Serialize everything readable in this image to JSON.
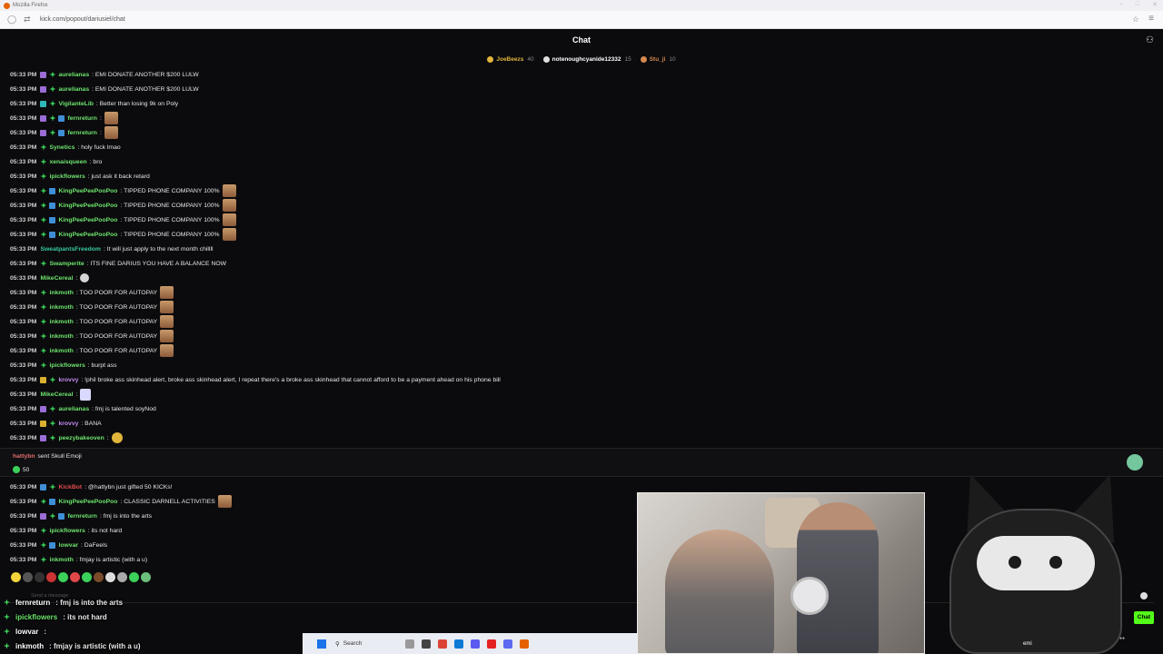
{
  "browser": {
    "title": "Mozilla Firefox",
    "url": "kick.com/popout/dariusiel/chat"
  },
  "chat": {
    "title": "Chat",
    "leaderboard": [
      {
        "user": "JoeBeezs",
        "count": "40",
        "color": "#e1b53b"
      },
      {
        "user": "notenoughcyanide12332",
        "count": "15",
        "color": "#e0e0e0"
      },
      {
        "user": "Stu_ji",
        "count": "10",
        "color": "#d5884f"
      }
    ],
    "messages": [
      {
        "ts": "05:33 PM",
        "badges": [
          "sub",
          "gift"
        ],
        "user": "aurelianas",
        "color": "#6ee46e",
        "text": ": EMI DONATE ANOTHER $200 LULW",
        "emote": ""
      },
      {
        "ts": "05:33 PM",
        "badges": [
          "sub",
          "gift"
        ],
        "user": "aurelianas",
        "color": "#6ee46e",
        "text": ": EMI DONATE ANOTHER $200 LULW",
        "emote": ""
      },
      {
        "ts": "05:33 PM",
        "badges": [
          "bot",
          "gift"
        ],
        "user": "VigilanteLib",
        "color": "#6ee46e",
        "text": ": Better than losing 9k on Poly",
        "emote": ""
      },
      {
        "ts": "05:33 PM",
        "badges": [
          "sub",
          "gift",
          "blue"
        ],
        "user": "fernreturn",
        "color": "#6ee46e",
        "text": ":",
        "emote": "face"
      },
      {
        "ts": "05:33 PM",
        "badges": [
          "sub",
          "gift",
          "blue"
        ],
        "user": "fernreturn",
        "color": "#6ee46e",
        "text": ":",
        "emote": "face"
      },
      {
        "ts": "05:33 PM",
        "badges": [
          "gift"
        ],
        "user": "Synetics",
        "color": "#6ee46e",
        "text": ": holy fuck lmao",
        "emote": ""
      },
      {
        "ts": "05:33 PM",
        "badges": [
          "gift"
        ],
        "user": "xenaisqueen",
        "color": "#6ee46e",
        "text": ": bro",
        "emote": ""
      },
      {
        "ts": "05:33 PM",
        "badges": [
          "gift"
        ],
        "user": "ipickflowers",
        "color": "#6ee46e",
        "text": ": just ask it back retard",
        "emote": ""
      },
      {
        "ts": "05:33 PM",
        "badges": [
          "gift",
          "blue"
        ],
        "user": "KingPeePeePooPoo",
        "color": "#6ee46e",
        "text": ": TIPPED PHONE COMPANY 100%",
        "emote": "face"
      },
      {
        "ts": "05:33 PM",
        "badges": [
          "gift",
          "blue"
        ],
        "user": "KingPeePeePooPoo",
        "color": "#6ee46e",
        "text": ": TIPPED PHONE COMPANY 100%",
        "emote": "face"
      },
      {
        "ts": "05:33 PM",
        "badges": [
          "gift",
          "blue"
        ],
        "user": "KingPeePeePooPoo",
        "color": "#6ee46e",
        "text": ": TIPPED PHONE COMPANY 100%",
        "emote": "face"
      },
      {
        "ts": "05:33 PM",
        "badges": [
          "gift",
          "blue"
        ],
        "user": "KingPeePeePooPoo",
        "color": "#6ee46e",
        "text": ": TIPPED PHONE COMPANY 100%",
        "emote": "face"
      },
      {
        "ts": "05:33 PM",
        "badges": [],
        "user": "SweatpantsFreedom",
        "color": "#38c9a0",
        "text": ": It will just apply to the next month chillll",
        "emote": ""
      },
      {
        "ts": "05:33 PM",
        "badges": [
          "gift"
        ],
        "user": "Swamperite",
        "color": "#6ee46e",
        "text": ": ITS FINE DARIUS YOU HAVE A BALANCE NOW",
        "emote": ""
      },
      {
        "ts": "05:33 PM",
        "badges": [],
        "user": "MikeCereal",
        "color": "#6ee46e",
        "text": ":",
        "emote": "small"
      },
      {
        "ts": "05:33 PM",
        "badges": [
          "gift"
        ],
        "user": "inkmoth",
        "color": "#6ee46e",
        "text": ": TOO POOR FOR AUTOPAY",
        "emote": "face"
      },
      {
        "ts": "05:33 PM",
        "badges": [
          "gift"
        ],
        "user": "inkmoth",
        "color": "#6ee46e",
        "text": ": TOO POOR FOR AUTOPAY",
        "emote": "face"
      },
      {
        "ts": "05:33 PM",
        "badges": [
          "gift"
        ],
        "user": "inkmoth",
        "color": "#6ee46e",
        "text": ": TOO POOR FOR AUTOPAY",
        "emote": "face"
      },
      {
        "ts": "05:33 PM",
        "badges": [
          "gift"
        ],
        "user": "inkmoth",
        "color": "#6ee46e",
        "text": ": TOO POOR FOR AUTOPAY",
        "emote": "face"
      },
      {
        "ts": "05:33 PM",
        "badges": [
          "gift"
        ],
        "user": "inkmoth",
        "color": "#6ee46e",
        "text": ": TOO POOR FOR AUTOPAY",
        "emote": "face"
      },
      {
        "ts": "05:33 PM",
        "badges": [
          "gift"
        ],
        "user": "ipickflowers",
        "color": "#6ee46e",
        "text": ": burpt ass",
        "emote": ""
      },
      {
        "ts": "05:33 PM",
        "badges": [
          "vip",
          "gift"
        ],
        "user": "krovvy",
        "color": "#c58af0",
        "text": ": !phil broke ass skinhead alert, broke ass skinhead alert, I repeat there's a broke ass skinhead that cannot afford to be a payment ahead on his phone bill",
        "emote": ""
      },
      {
        "ts": "05:33 PM",
        "badges": [],
        "user": "MikeCereal",
        "color": "#6ee46e",
        "text": ":",
        "emote": "w"
      },
      {
        "ts": "05:33 PM",
        "badges": [
          "sub",
          "gift"
        ],
        "user": "aurelianas",
        "color": "#6ee46e",
        "text": ": fmj is talented soyNod",
        "emote": ""
      },
      {
        "ts": "05:33 PM",
        "badges": [
          "vip",
          "gift"
        ],
        "user": "krovvy",
        "color": "#c58af0",
        "text": ": BANA",
        "emote": ""
      },
      {
        "ts": "05:33 PM",
        "badges": [
          "sub",
          "gift"
        ],
        "user": "peezybakeoven",
        "color": "#6ee46e",
        "text": ":",
        "emote": "gold"
      }
    ],
    "gift_banner": {
      "user": "hattybn",
      "text": "sent Skull Emoji",
      "count": "50"
    },
    "messages2": [
      {
        "ts": "05:33 PM",
        "badges": [
          "blue",
          "gift"
        ],
        "user": "KickBot",
        "color": "#e34b4b",
        "text": ": @hattybn just gifted 50 KICKs!",
        "emote": ""
      },
      {
        "ts": "05:33 PM",
        "badges": [
          "gift",
          "blue"
        ],
        "user": "KingPeePeePooPoo",
        "color": "#6ee46e",
        "text": ": CLASSIC DARNELL ACTIVITIES",
        "emote": "face"
      },
      {
        "ts": "05:33 PM",
        "badges": [
          "sub",
          "gift",
          "blue"
        ],
        "user": "fernreturn",
        "color": "#6ee46e",
        "text": ": fmj is into the arts",
        "emote": ""
      },
      {
        "ts": "05:33 PM",
        "badges": [
          "gift"
        ],
        "user": "ipickflowers",
        "color": "#6ee46e",
        "text": ": its not hard",
        "emote": ""
      },
      {
        "ts": "05:33 PM",
        "badges": [
          "gift",
          "blue"
        ],
        "user": "lowvar",
        "color": "#6ee46e",
        "text": ": DaFeels",
        "emote": ""
      },
      {
        "ts": "05:33 PM",
        "badges": [
          "gift"
        ],
        "user": "inkmoth",
        "color": "#6ee46e",
        "text": ": fmjay is artistic (with a u)",
        "emote": ""
      }
    ],
    "input_placeholder": "Send a message",
    "send_label": "Chat"
  },
  "overlay": {
    "cat_label": "emi",
    "lines": [
      {
        "user": "fernreturn",
        "text": ": fmj is into the arts",
        "color": "#ffffff"
      },
      {
        "user": "ipickflowers",
        "text": ": its not hard",
        "color": "#6ee46e"
      },
      {
        "user": "lowvar",
        "text": ":",
        "color": "#ffffff"
      },
      {
        "user": "inkmoth",
        "text": ": fmjay is artistic (with a u)",
        "color": "#ffffff"
      }
    ]
  },
  "taskbar": {
    "search_label": "Search"
  }
}
